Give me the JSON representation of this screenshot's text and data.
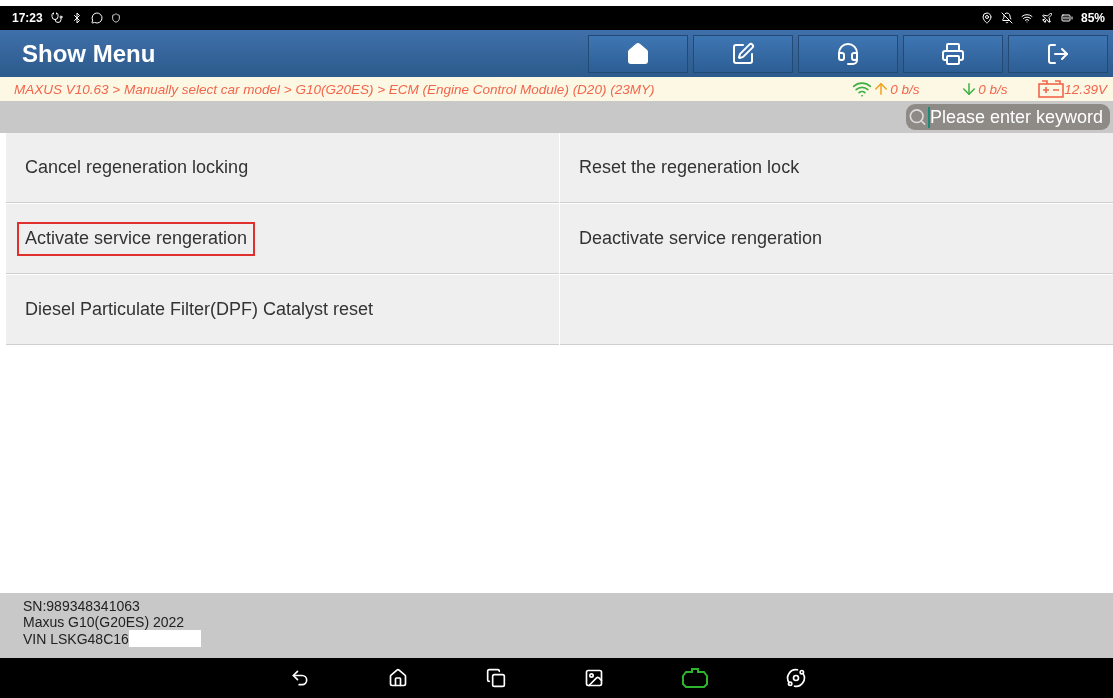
{
  "status_bar": {
    "time": "17:23",
    "battery": "85%"
  },
  "header": {
    "title": "Show Menu"
  },
  "breadcrumb": {
    "path": "MAXUS V10.63 > Manually select car model > G10(G20ES) > ECM (Engine Control Module) (D20) (23MY)",
    "upload": "0 b/s",
    "download": "0 b/s",
    "voltage": "12.39V"
  },
  "search": {
    "placeholder": "Please enter keyword"
  },
  "menu_items": [
    {
      "label": "Cancel regeneration locking",
      "highlighted": false
    },
    {
      "label": "Reset the regeneration lock",
      "highlighted": false
    },
    {
      "label": "Activate service rengeration",
      "highlighted": true
    },
    {
      "label": "Deactivate service rengeration",
      "highlighted": false
    },
    {
      "label": "Diesel Particulate Filter(DPF) Catalyst reset",
      "highlighted": false
    }
  ],
  "footer": {
    "lines": [
      "SN:989348341063",
      "Maxus G10(G20ES) 2022",
      "VIN LSKG48C16"
    ]
  }
}
